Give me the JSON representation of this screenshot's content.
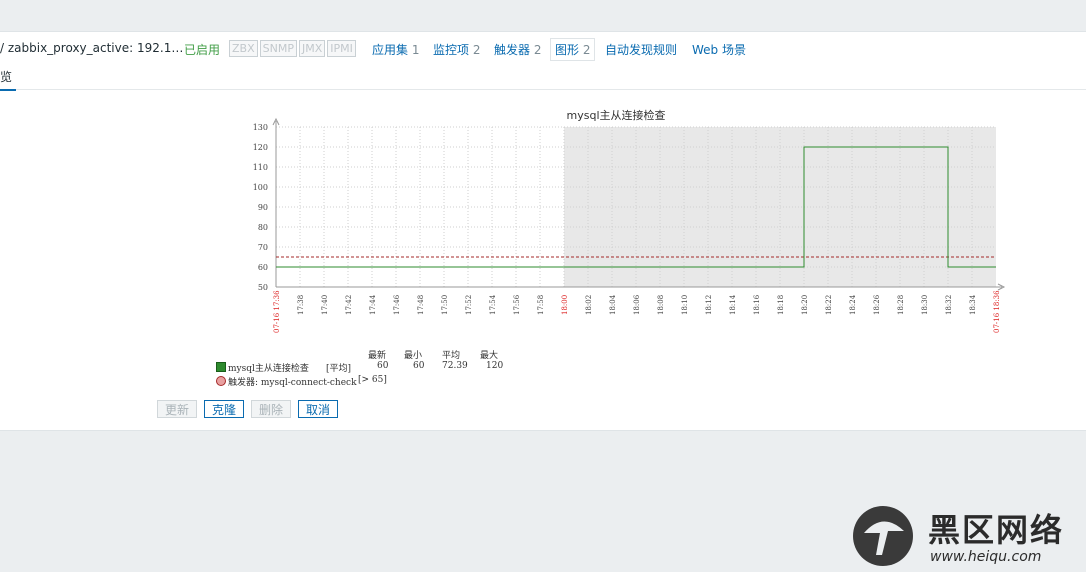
{
  "header": {
    "breadcrumb": "/ zabbix_proxy_active: 192.1…",
    "status": "已启用",
    "availability": [
      "ZBX",
      "SNMP",
      "JMX",
      "IPMI"
    ],
    "links": [
      {
        "label": "应用集",
        "count": "1"
      },
      {
        "label": "监控项",
        "count": "2"
      },
      {
        "label": "触发器",
        "count": "2"
      },
      {
        "label": "图形",
        "count": "2"
      },
      {
        "label": "自动发现规则",
        "count": ""
      },
      {
        "label": "Web 场景",
        "count": ""
      }
    ]
  },
  "tabs": {
    "active": "览"
  },
  "chart_data": {
    "type": "line",
    "title": "mysql主从连接检查",
    "ylim": [
      50,
      130
    ],
    "yticks": [
      50,
      60,
      70,
      80,
      90,
      100,
      110,
      120,
      130
    ],
    "x_start_label": "07-16 17:36",
    "x_end_label": "07-16 18:36",
    "xticks": [
      "17:38",
      "17:40",
      "17:42",
      "17:44",
      "17:46",
      "17:48",
      "17:50",
      "17:52",
      "17:54",
      "17:56",
      "17:58",
      "18:00",
      "18:02",
      "18:04",
      "18:06",
      "18:08",
      "18:10",
      "18:12",
      "18:14",
      "18:16",
      "18:18",
      "18:20",
      "18:22",
      "18:24",
      "18:26",
      "18:28",
      "18:30",
      "18:32",
      "18:34"
    ],
    "highlight_tick": "18:00",
    "shaded_from": "18:00",
    "series": [
      {
        "name": "mysql主从连接检查",
        "color": "#2e8b2e",
        "points": [
          [
            "17:36",
            60
          ],
          [
            "18:20",
            60
          ],
          [
            "18:20",
            120
          ],
          [
            "18:32",
            120
          ],
          [
            "18:32",
            60
          ],
          [
            "18:36",
            60
          ]
        ]
      }
    ],
    "trigger": {
      "value": 65,
      "color": "#a52a2a"
    },
    "grid": true
  },
  "legend": {
    "headers": [
      "最新",
      "最小",
      "平均",
      "最大"
    ],
    "item": {
      "name": "mysql主从连接检查",
      "func": "[平均]",
      "last": "60",
      "min": "60",
      "avg": "72.39",
      "max": "120"
    },
    "trigger": {
      "label": "触发器: mysql-connect-check",
      "cond": "[> 65]"
    }
  },
  "buttons": {
    "update": "更新",
    "clone": "克隆",
    "delete": "删除",
    "cancel": "取消"
  },
  "watermark": {
    "text": "黑区网络",
    "url": "www.heiqu.com"
  }
}
